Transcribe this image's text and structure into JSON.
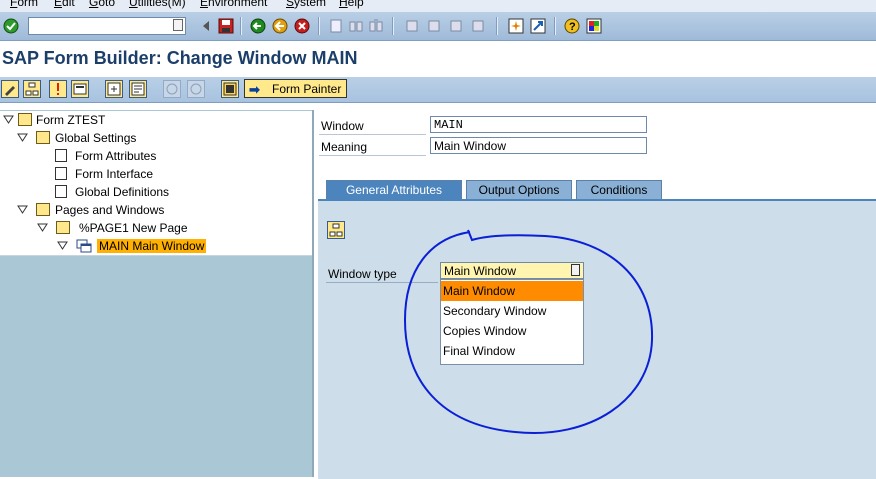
{
  "menu": [
    "Form",
    "Edit",
    "Goto",
    "Utilities(M)",
    "Environment",
    "System",
    "Help"
  ],
  "title": "SAP Form Builder: Change Window MAIN",
  "app_toolbar": {
    "form_painter_label": "Form Painter"
  },
  "tree": {
    "form": "Form ZTEST",
    "global_settings": "Global Settings",
    "form_attributes": "Form Attributes",
    "form_interface": "Form Interface",
    "global_definitions": "Global Definitions",
    "pages_and_windows": "Pages and Windows",
    "page1": "%PAGE1 New Page",
    "main_window": "MAIN Main Window"
  },
  "header_fields": {
    "window_label": "Window",
    "window_value": "MAIN",
    "meaning_label": "Meaning",
    "meaning_value": "Main Window"
  },
  "tabs": [
    "General Attributes",
    "Output Options",
    "Conditions"
  ],
  "window_type": {
    "label": "Window type",
    "selected": "Main Window",
    "options": [
      "Main Window",
      "Secondary Window",
      "Copies Window",
      "Final Window"
    ]
  },
  "colors": {
    "title": "#1c3f6a",
    "active_tab": "#4c84bd",
    "selected_option": "#ff8c00",
    "annotation": "#0a1fd6"
  }
}
